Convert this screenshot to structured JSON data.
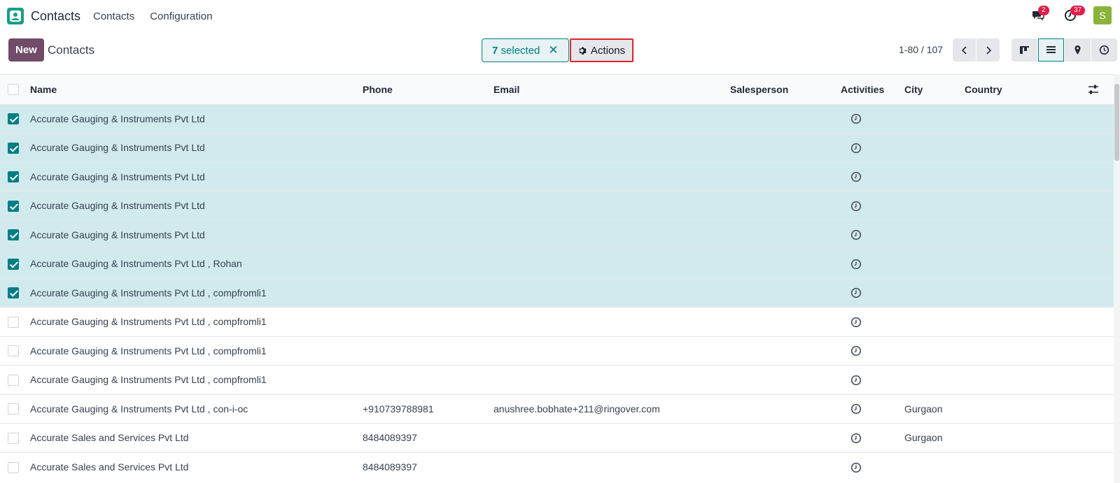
{
  "navbar": {
    "app_name": "Contacts",
    "menu": [
      "Contacts",
      "Configuration"
    ],
    "messages_count": "2",
    "activities_count": "37",
    "avatar_letter": "S"
  },
  "control": {
    "new_label": "New",
    "breadcrumb": "Contacts",
    "selected_count": "7",
    "selected_label": "selected",
    "actions_label": "Actions",
    "pager": "1-80 / 107"
  },
  "table": {
    "columns": {
      "name": "Name",
      "phone": "Phone",
      "email": "Email",
      "salesperson": "Salesperson",
      "activities": "Activities",
      "city": "City",
      "country": "Country"
    },
    "rows": [
      {
        "selected": true,
        "name": "Accurate Gauging & Instruments Pvt Ltd",
        "phone": "",
        "email": "",
        "salesperson": "",
        "city": "",
        "country": ""
      },
      {
        "selected": true,
        "name": "Accurate Gauging & Instruments Pvt Ltd",
        "phone": "",
        "email": "",
        "salesperson": "",
        "city": "",
        "country": ""
      },
      {
        "selected": true,
        "name": "Accurate Gauging & Instruments Pvt Ltd",
        "phone": "",
        "email": "",
        "salesperson": "",
        "city": "",
        "country": ""
      },
      {
        "selected": true,
        "name": "Accurate Gauging & Instruments Pvt Ltd",
        "phone": "",
        "email": "",
        "salesperson": "",
        "city": "",
        "country": ""
      },
      {
        "selected": true,
        "name": "Accurate Gauging & Instruments Pvt Ltd",
        "phone": "",
        "email": "",
        "salesperson": "",
        "city": "",
        "country": ""
      },
      {
        "selected": true,
        "name": "Accurate Gauging & Instruments Pvt Ltd , Rohan",
        "phone": "",
        "email": "",
        "salesperson": "",
        "city": "",
        "country": ""
      },
      {
        "selected": true,
        "name": "Accurate Gauging & Instruments Pvt Ltd , compfromli1",
        "phone": "",
        "email": "",
        "salesperson": "",
        "city": "",
        "country": ""
      },
      {
        "selected": false,
        "name": "Accurate Gauging & Instruments Pvt Ltd , compfromli1",
        "phone": "",
        "email": "",
        "salesperson": "",
        "city": "",
        "country": ""
      },
      {
        "selected": false,
        "name": "Accurate Gauging & Instruments Pvt Ltd , compfromli1",
        "phone": "",
        "email": "",
        "salesperson": "",
        "city": "",
        "country": ""
      },
      {
        "selected": false,
        "name": "Accurate Gauging & Instruments Pvt Ltd , compfromli1",
        "phone": "",
        "email": "",
        "salesperson": "",
        "city": "",
        "country": ""
      },
      {
        "selected": false,
        "name": "Accurate Gauging & Instruments Pvt Ltd , con-i-oc",
        "phone": "+910739788981",
        "email": "anushree.bobhate+211@ringover.com",
        "salesperson": "",
        "city": "Gurgaon",
        "country": ""
      },
      {
        "selected": false,
        "name": "Accurate Sales and Services Pvt Ltd",
        "phone": "8484089397",
        "email": "",
        "salesperson": "",
        "city": "Gurgaon",
        "country": ""
      },
      {
        "selected": false,
        "name": "Accurate Sales and Services Pvt Ltd",
        "phone": "8484089397",
        "email": "",
        "salesperson": "",
        "city": "",
        "country": ""
      }
    ]
  },
  "colors": {
    "brand": "#714b67",
    "accent": "#017e84",
    "selected_row": "#d1eaee",
    "badge": "#e11d48"
  }
}
